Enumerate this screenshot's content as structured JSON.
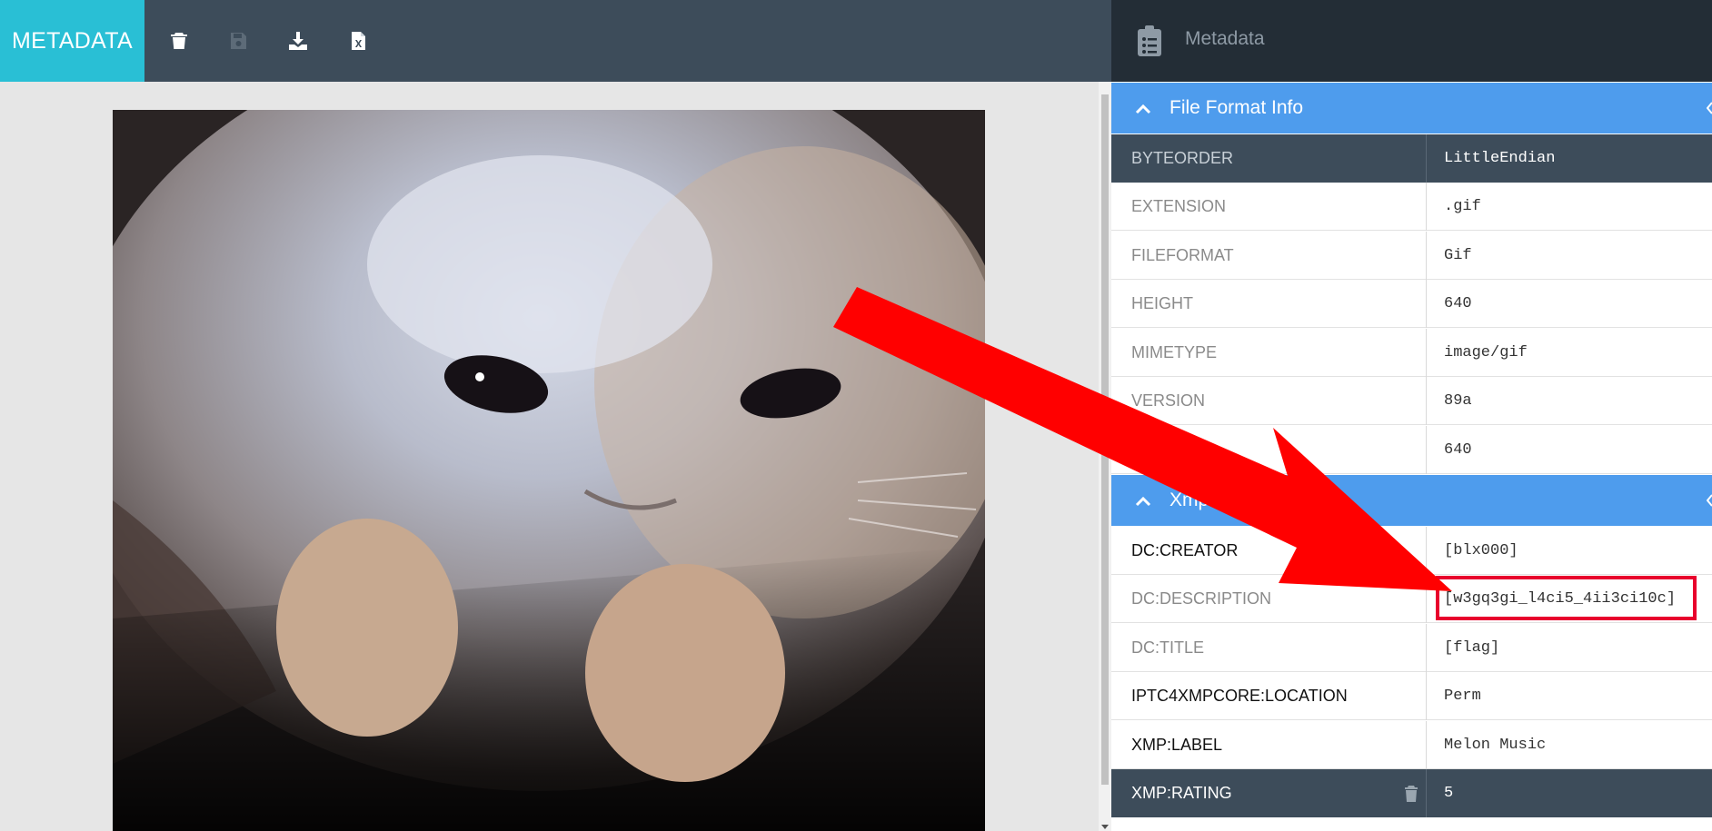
{
  "app": {
    "brand": "METADATA",
    "toolbar": {
      "delete": "trash-icon",
      "save": "save-icon",
      "download": "download-icon",
      "excel": "excel-icon"
    }
  },
  "panel": {
    "title": "Metadata",
    "icon": "clipboard-icon",
    "sections": [
      {
        "title": "File Format Info",
        "rows": [
          {
            "key": "BYTEORDER",
            "value": "LittleEndian"
          },
          {
            "key": "EXTENSION",
            "value": ".gif"
          },
          {
            "key": "FILEFORMAT",
            "value": "Gif"
          },
          {
            "key": "HEIGHT",
            "value": "640"
          },
          {
            "key": "MIMETYPE",
            "value": "image/gif"
          },
          {
            "key": "VERSION",
            "value": "89a"
          },
          {
            "key": "",
            "value": "640"
          }
        ]
      },
      {
        "title": "Xmp",
        "rows": [
          {
            "key": "DC:CREATOR",
            "value": "[blx000]"
          },
          {
            "key": "DC:DESCRIPTION",
            "value": "[w3gq3gi_l4ci5_4ii3ci10c]"
          },
          {
            "key": "DC:TITLE",
            "value": "[flag]"
          },
          {
            "key": "IPTC4XMPCORE:LOCATION",
            "value": "Perm"
          },
          {
            "key": "XMP:LABEL",
            "value": "Melon Music"
          },
          {
            "key": "XMP:RATING",
            "value": "5"
          }
        ]
      }
    ]
  },
  "colors": {
    "brand": "#29bfd5",
    "toolbar": "#3d4c5a",
    "section": "#4e9ced",
    "annotation": "#ff0000"
  }
}
